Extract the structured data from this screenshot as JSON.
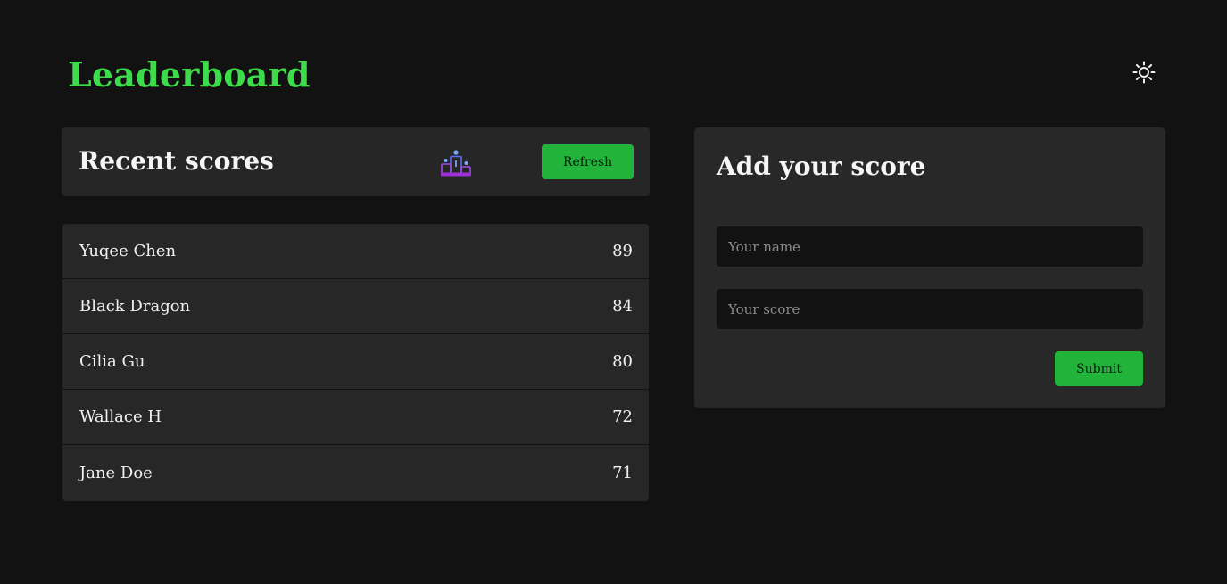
{
  "header": {
    "title": "Leaderboard",
    "theme_icon": "sun-icon"
  },
  "recent": {
    "title": "Recent scores",
    "icon": "podium-icon",
    "refresh_label": "Refresh",
    "scores": [
      {
        "name": "Yuqee Chen",
        "score": "89"
      },
      {
        "name": "Black Dragon",
        "score": "84"
      },
      {
        "name": "Cilia Gu",
        "score": "80"
      },
      {
        "name": "Wallace H",
        "score": "72"
      },
      {
        "name": "Jane Doe",
        "score": "71"
      }
    ]
  },
  "form": {
    "title": "Add your score",
    "name_placeholder": "Your name",
    "name_value": "",
    "score_placeholder": "Your score",
    "score_value": "",
    "submit_label": "Submit"
  },
  "colors": {
    "background": "#121212",
    "panel": "#282828",
    "accent": "#22b33a",
    "title": "#3ddc4a"
  }
}
